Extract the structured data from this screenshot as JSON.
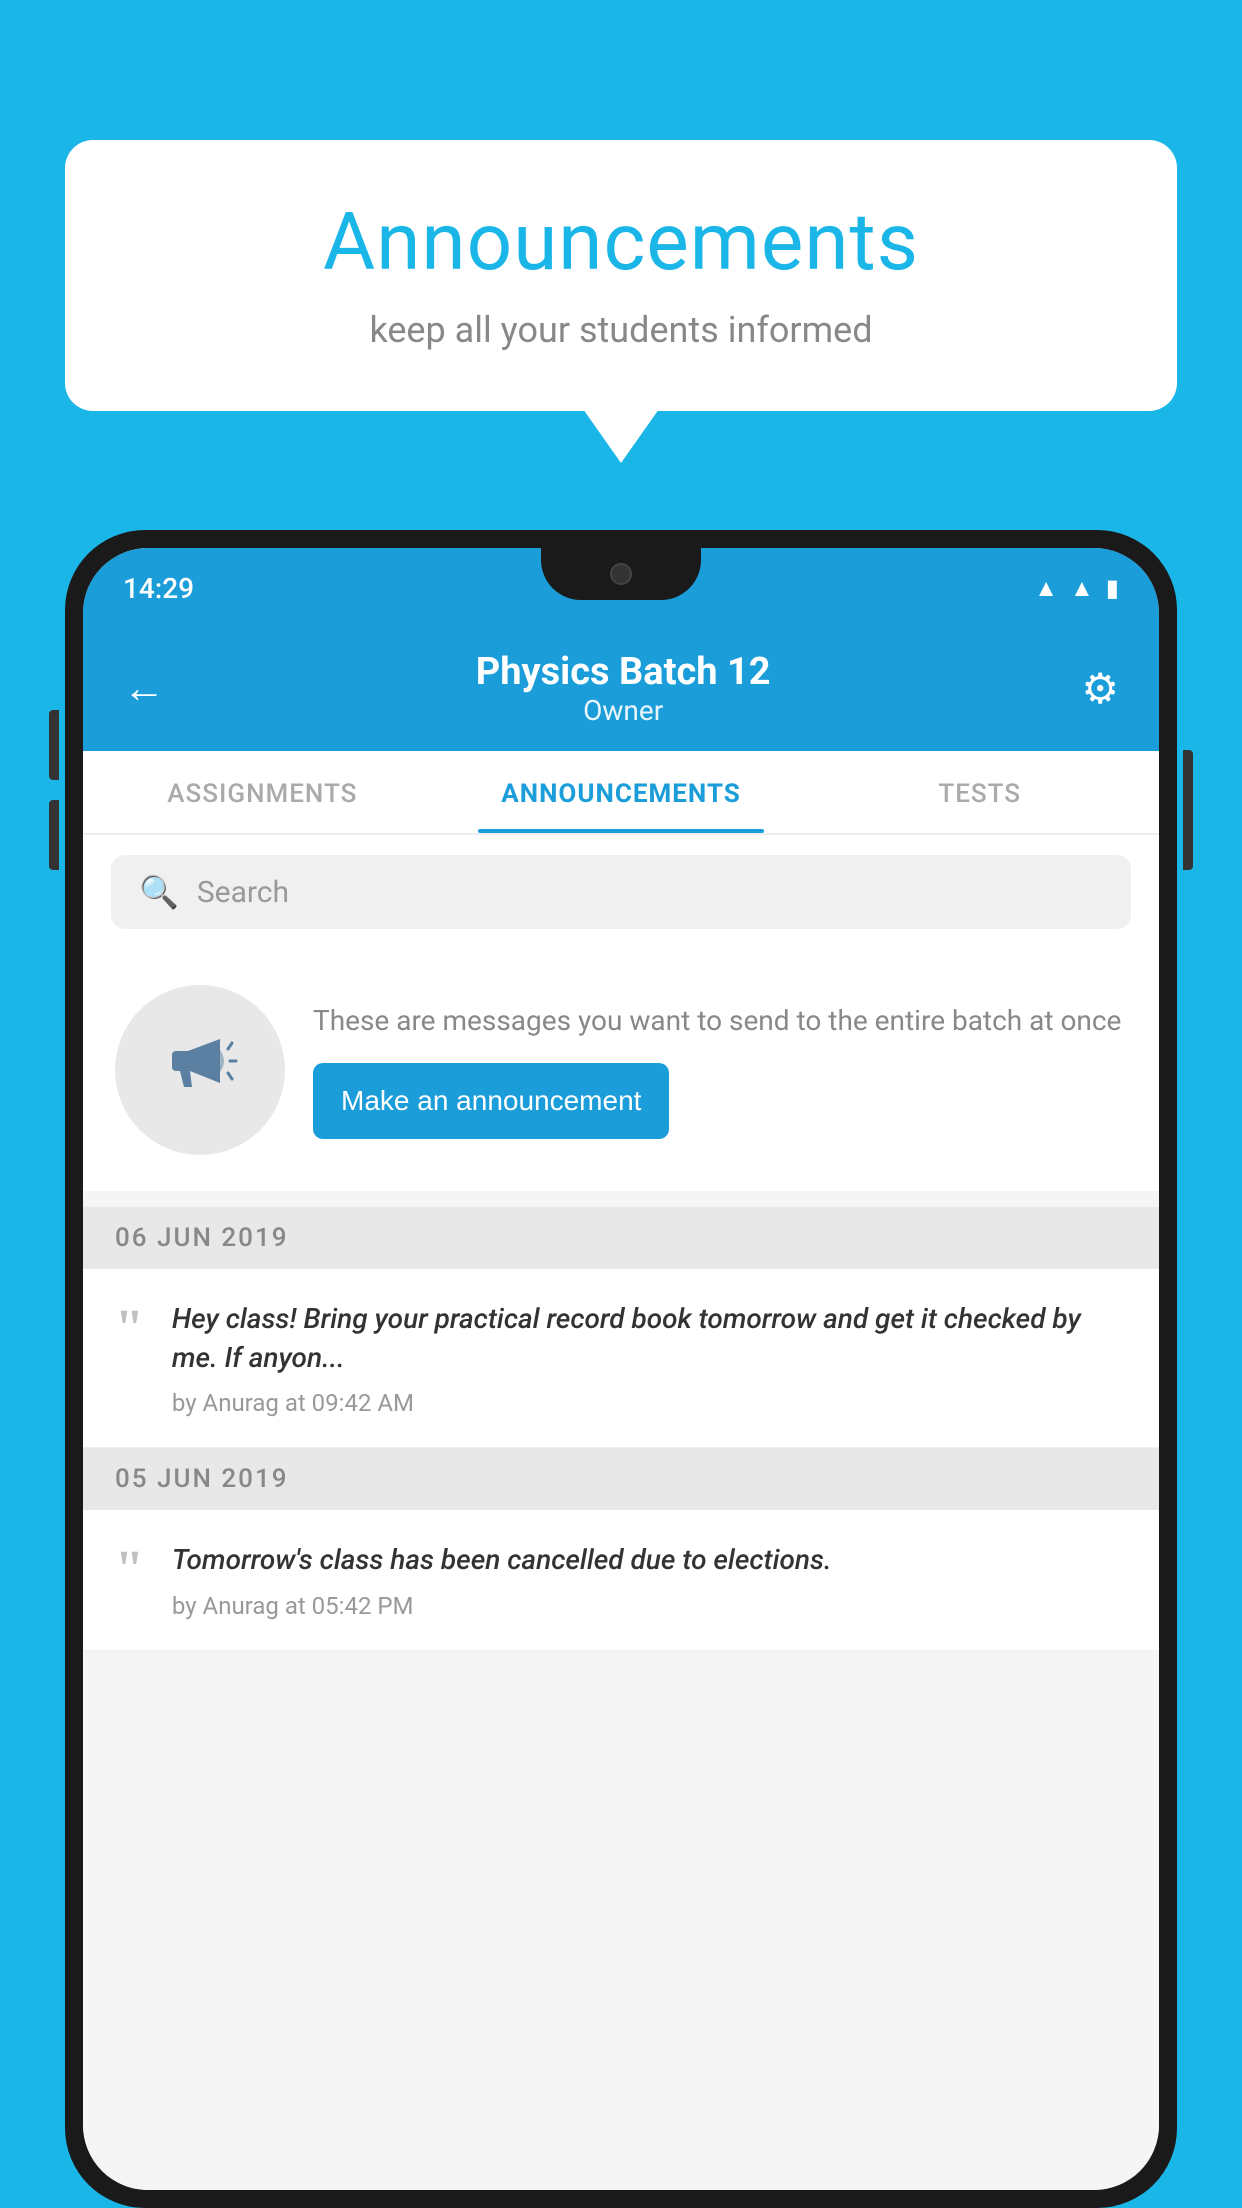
{
  "background_color": "#1ab6e8",
  "speech_bubble": {
    "title": "Announcements",
    "subtitle": "keep all your students informed"
  },
  "phone": {
    "status_bar": {
      "time": "14:29",
      "icons": [
        "wifi",
        "signal",
        "battery"
      ]
    },
    "header": {
      "title": "Physics Batch 12",
      "subtitle": "Owner",
      "back_label": "←",
      "gear_label": "⚙"
    },
    "tabs": [
      {
        "label": "ASSIGNMENTS",
        "active": false
      },
      {
        "label": "ANNOUNCEMENTS",
        "active": true
      },
      {
        "label": "TESTS",
        "active": false
      },
      {
        "label": "...",
        "active": false
      }
    ],
    "search": {
      "placeholder": "Search"
    },
    "promo_card": {
      "description": "These are messages you want to send to the entire batch at once",
      "button_label": "Make an announcement"
    },
    "announcements": [
      {
        "date": "06  JUN  2019",
        "text": "Hey class! Bring your practical record book tomorrow and get it checked by me. If anyon...",
        "meta": "by Anurag at 09:42 AM"
      },
      {
        "date": "05  JUN  2019",
        "text": "Tomorrow's class has been cancelled due to elections.",
        "meta": "by Anurag at 05:42 PM"
      }
    ]
  }
}
